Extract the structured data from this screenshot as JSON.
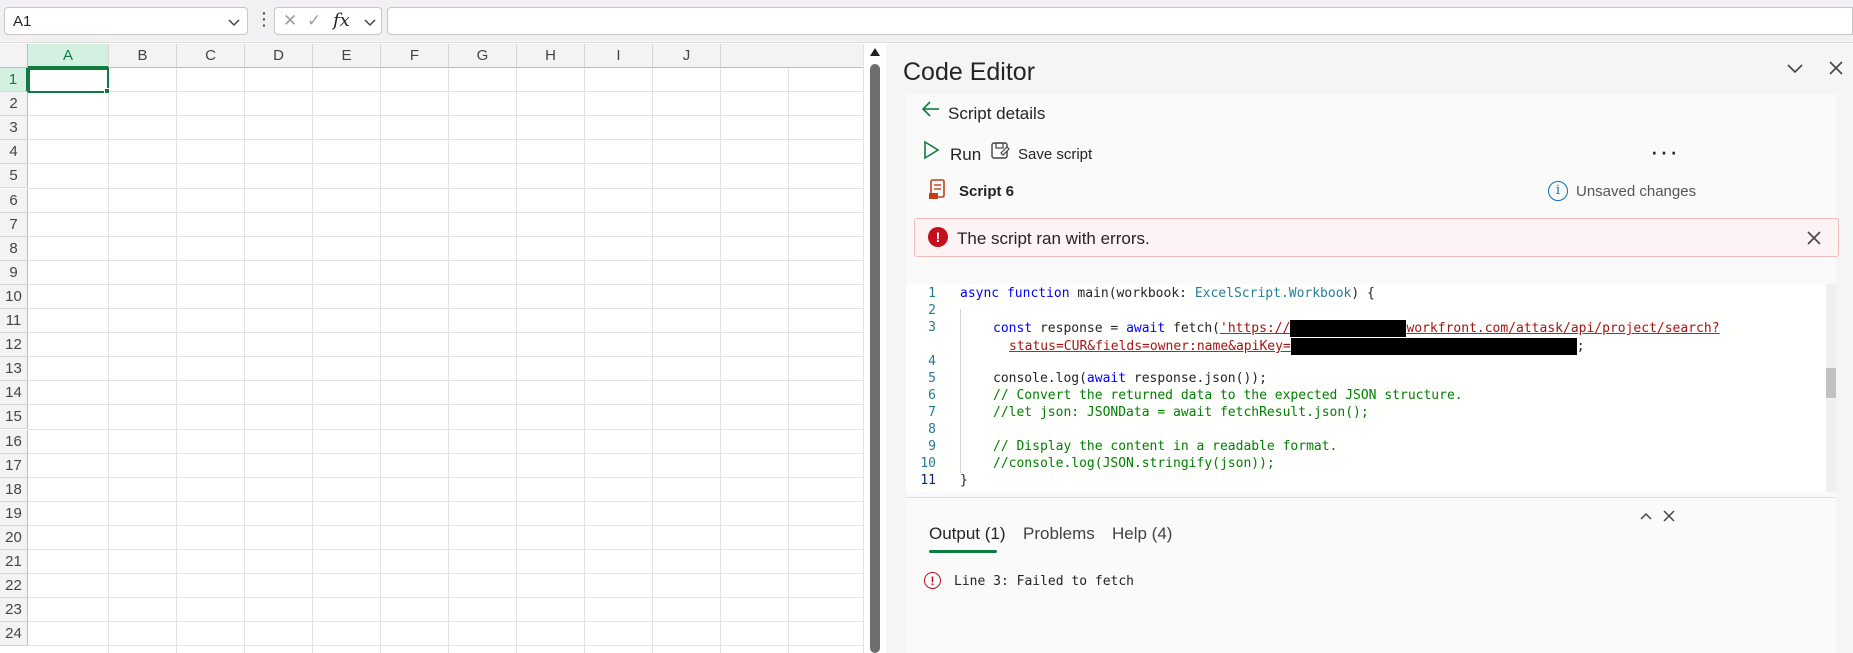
{
  "formula_bar": {
    "name_box": "A1",
    "more": "⋮",
    "cancel_icon": "✕",
    "enter_icon": "✓",
    "fx_label": "fx",
    "formula_value": ""
  },
  "sheet": {
    "columns": [
      "A",
      "B",
      "C",
      "D",
      "E",
      "F",
      "G",
      "H",
      "I",
      "J"
    ],
    "rows": [
      "1",
      "2",
      "3",
      "4",
      "5",
      "6",
      "7",
      "8",
      "9",
      "10",
      "11",
      "12",
      "13",
      "14",
      "15",
      "16",
      "17",
      "18",
      "19",
      "20",
      "21",
      "22",
      "23",
      "24"
    ],
    "selected_cell": "A1"
  },
  "editor": {
    "title": "Code Editor",
    "back_label": "Script details",
    "run_label": "Run",
    "save_label": "Save script",
    "script_name": "Script 6",
    "status": "Unsaved changes",
    "error_message": "The script ran with errors.",
    "code": {
      "line_numbers": [
        "1",
        "2",
        "3",
        "",
        "4",
        "5",
        "6",
        "7",
        "8",
        "9",
        "10",
        "11"
      ],
      "l1_kw1": "async",
      "l1_kw2": "function",
      "l1_a": " main(workbook: ",
      "l1_type": "ExcelScript.Workbook",
      "l1_b": ") {",
      "l3_kw1": "const",
      "l3_a": " response = ",
      "l3_kw2": "await",
      "l3_b": " fetch(",
      "l3_str1": "'https://",
      "l3_str2": "workfront.com/attask/api/project/search?",
      "l3b_str": "status=CUR&fields=owner:name&apiKey=",
      "l3b_end": ";",
      "l5_a": "console.log(",
      "l5_kw": "await",
      "l5_b": " response.json());",
      "l6": "// Convert the returned data to the expected JSON structure.",
      "l7": "//let json: JSONData = await fetchResult.json();",
      "l9": "// Display the content in a readable format.",
      "l10": "//console.log(JSON.stringify(json));",
      "l11": "}"
    },
    "output_tabs": [
      "Output (1)",
      "Problems",
      "Help (4)"
    ],
    "output_error": "Line 3: Failed to fetch"
  },
  "colors": {
    "accent": "#107c41",
    "error": "#c50f1f",
    "info": "#0f6cbd"
  }
}
